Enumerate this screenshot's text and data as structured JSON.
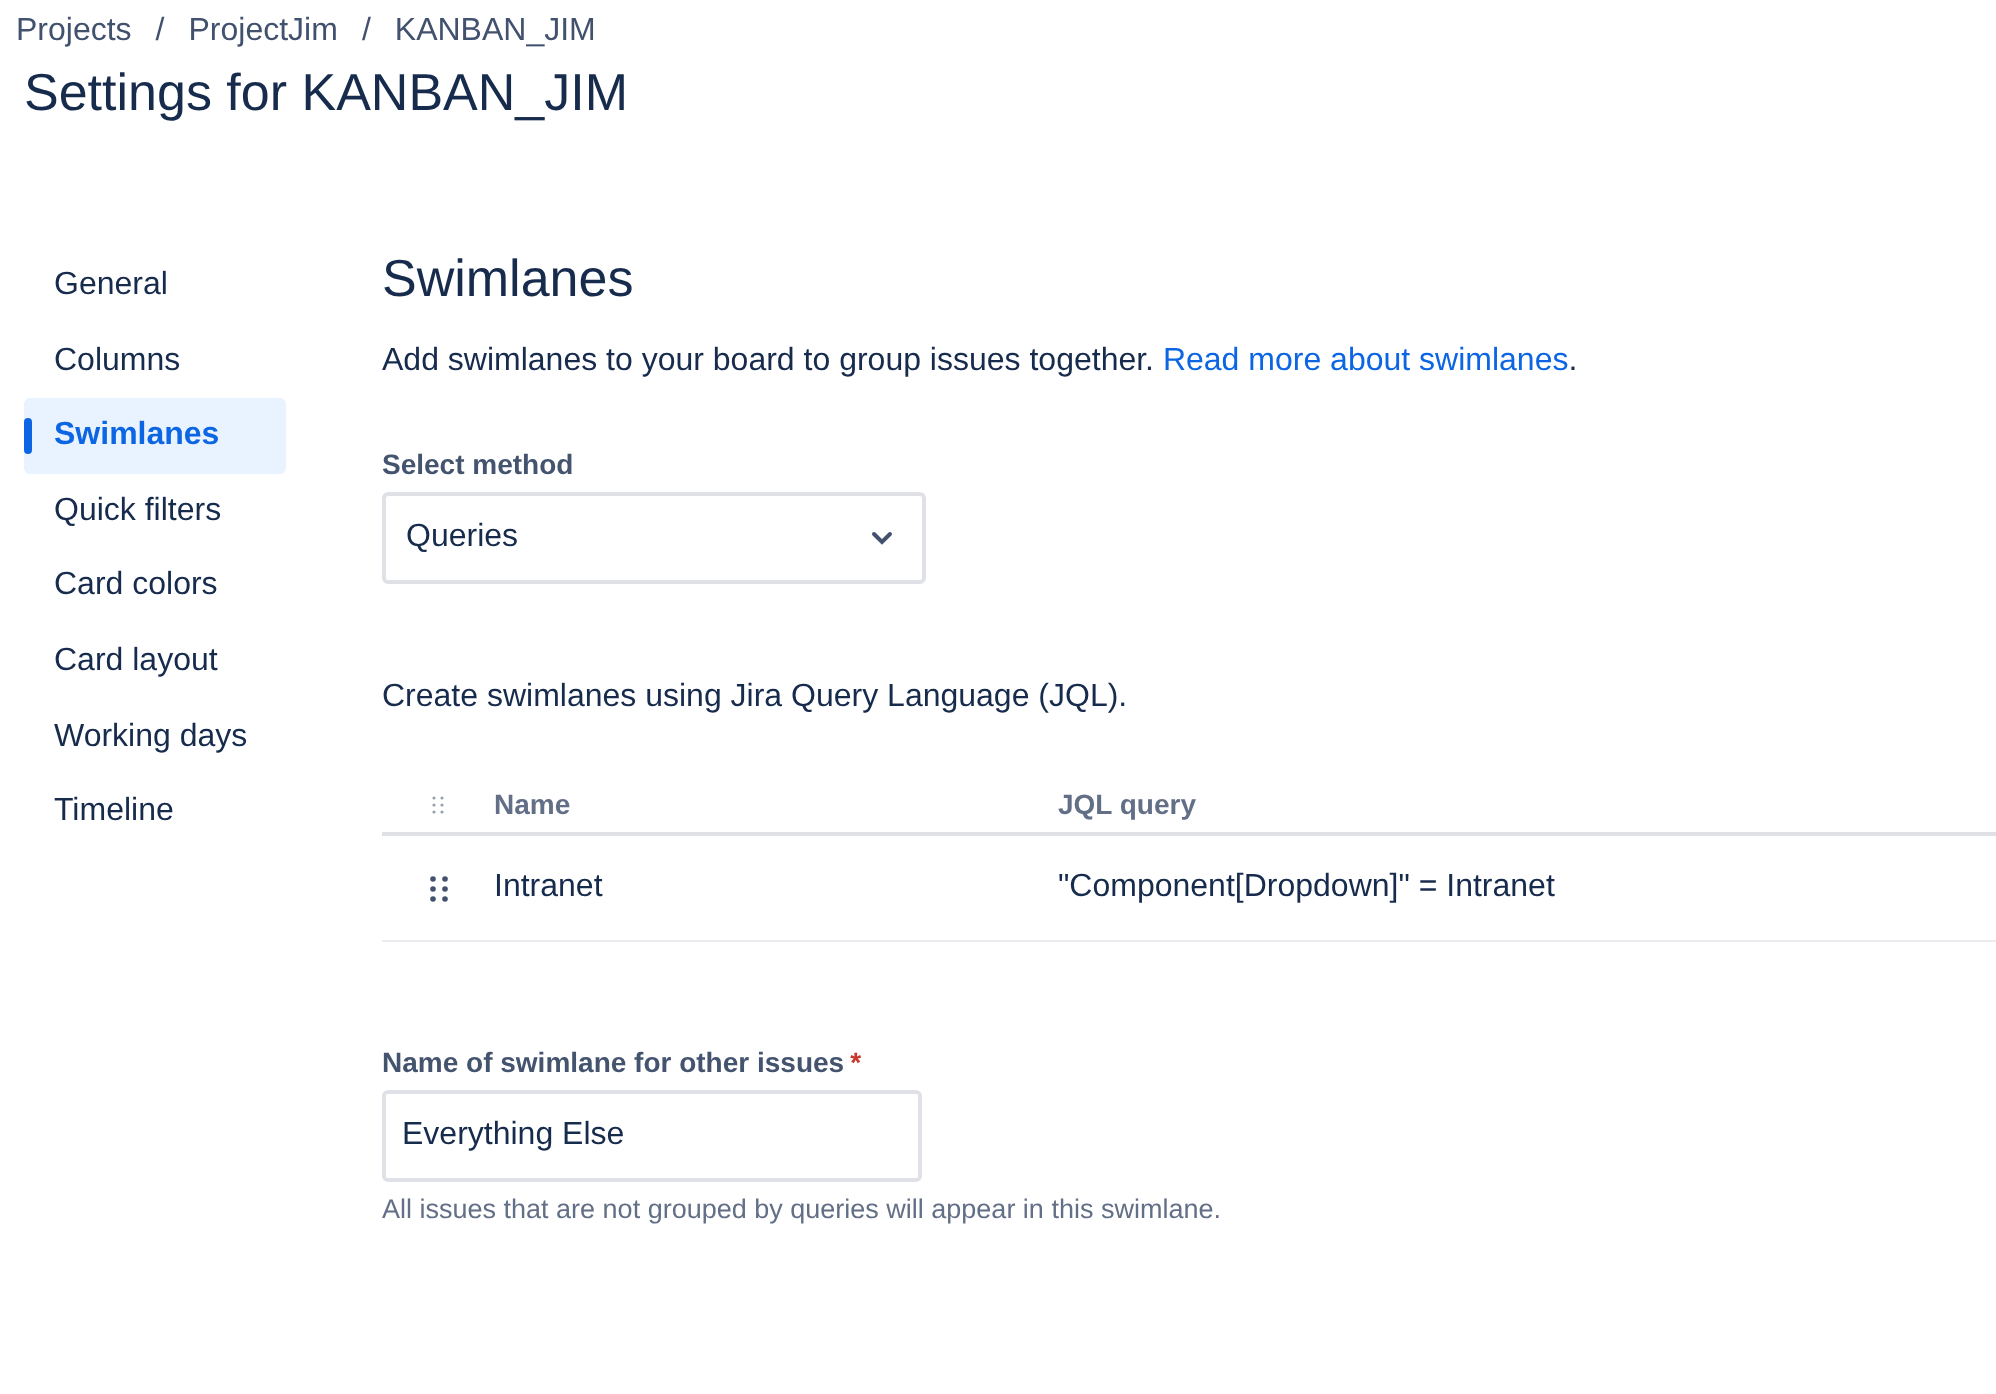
{
  "breadcrumbs": [
    "Projects",
    "ProjectJim",
    "KANBAN_JIM"
  ],
  "breadcrumb_separator": "/",
  "title": "Settings for KANBAN_JIM",
  "sidebar": {
    "items": [
      {
        "label": "General",
        "selected": false
      },
      {
        "label": "Columns",
        "selected": false
      },
      {
        "label": "Swimlanes",
        "selected": true
      },
      {
        "label": "Quick filters",
        "selected": false
      },
      {
        "label": "Card colors",
        "selected": false
      },
      {
        "label": "Card layout",
        "selected": false
      },
      {
        "label": "Working days",
        "selected": false
      },
      {
        "label": "Timeline",
        "selected": false
      }
    ]
  },
  "heading": "Swimlanes",
  "description": {
    "text": "Add swimlanes to your board to group issues together.",
    "link": "Read more about swimlanes",
    "after": "."
  },
  "method": {
    "label": "Select method",
    "value": "Queries"
  },
  "jql_note": "Create swimlanes using Jira Query Language (JQL).",
  "table": {
    "columns": [
      "Name",
      "JQL query"
    ],
    "rows": [
      {
        "name": "Intranet",
        "query": "\"Component[Dropdown]\" = Intranet"
      }
    ]
  },
  "other": {
    "label": "Name of swimlane for other issues",
    "required_mark": "*",
    "value": "Everything Else",
    "help": "All issues that are not grouped by queries will appear in this swimlane."
  }
}
